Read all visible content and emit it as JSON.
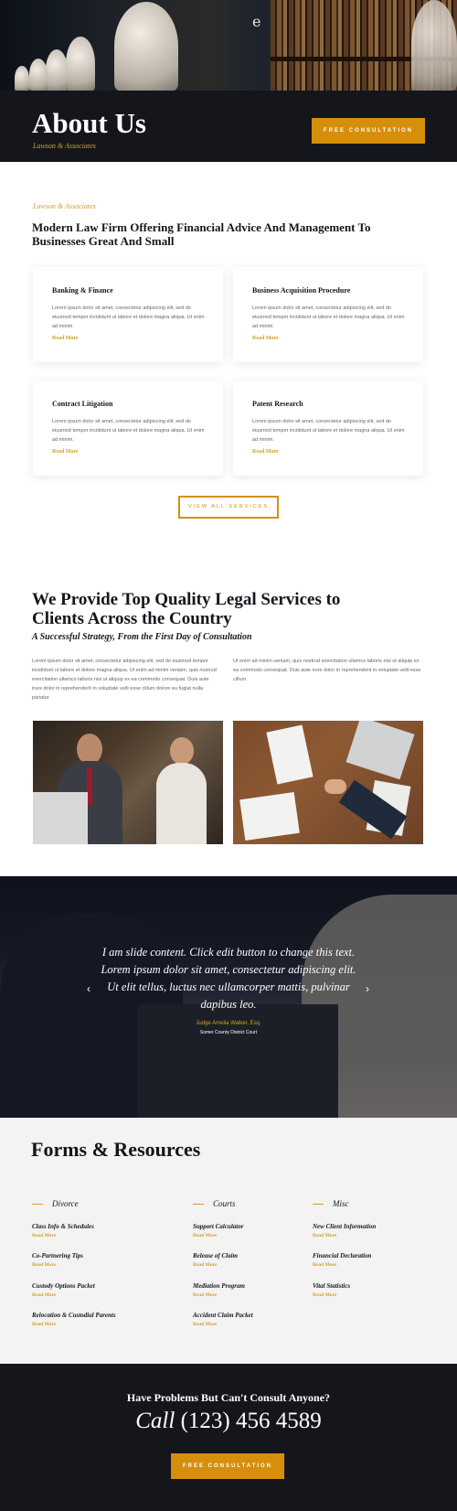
{
  "hero": {
    "logo_glyph": "e"
  },
  "header": {
    "title": "About Us",
    "subtitle": "Lawson & Associates",
    "cta_label": "FREE CONSULTATION"
  },
  "intro": {
    "eyebrow": "Lawson & Associates",
    "heading": "Modern Law Firm Offering Financial Advice And Management To Businesses Great And Small"
  },
  "services": [
    {
      "title": "Banking & Finance",
      "body": "Lorem ipsum dolor sit amet, consectetur adipiscing elit, sed do eiusmod tempor incididunt ut labore et dolore magna aliqua. Ut enim ad minim.",
      "link": "Read More"
    },
    {
      "title": "Business Acquisition Procedure",
      "body": "Lorem ipsum dolor sit amet, consectetur adipiscing elit, sed do eiusmod tempor incididunt ut labore et dolore magna aliqua. Ut enim ad minim.",
      "link": "Read More"
    },
    {
      "title": "Contract Litigation",
      "body": "Lorem ipsum dolor sit amet, consectetur adipiscing elit, sed do eiusmod tempor incididunt ut labore et dolore magna aliqua. Ut enim ad minim.",
      "link": "Read More"
    },
    {
      "title": "Patent Research",
      "body": "Lorem ipsum dolor sit amet, consectetur adipiscing elit, sed do eiusmod tempor incididunt ut labore et dolore magna aliqua. Ut enim ad minim.",
      "link": "Read More"
    }
  ],
  "view_all_label": "VIEW ALL SERVICES",
  "quality": {
    "heading": "We Provide Top Quality Legal Services to Clients Across the Country",
    "subheading": "A Successful Strategy, From the First Day of Consultation",
    "col1": "Lorem ipsum dolor sit amet, consectetur adipiscing elit, sed do eiusmod tempor incididunt ut labore et dolore magna aliqua. Ut enim ad minim veniam, quis nostrud exercitation ullamco laboris nisi ut aliquip ex ea commodo consequat. Duis aute irure dolor in reprehenderit in voluptate velit esse cillum dolore eu fugiat nulla pariatur.",
    "col2": "Ut enim ad minim veniam, quis nostrud exercitation ullamco laboris nisi ut aliquip ex ea commodo consequat. Duis aute irure dolor in reprehenderit in voluptate velit esse cillum."
  },
  "slider": {
    "quote": "I am slide content. Click edit button to change this text. Lorem ipsum dolor sit amet, consectetur adipiscing elit. Ut elit tellus, luctus nec ullamcorper mattis, pulvinar dapibus leo.",
    "name": "Judge Amelia Walker, Esq.",
    "role": "Somer County District Court",
    "prev": "‹",
    "next": "›"
  },
  "forms": {
    "heading": "Forms & Resources",
    "columns": [
      {
        "title": "Divorce",
        "items": [
          {
            "label": "Class Info & Schedules",
            "link": "Read More"
          },
          {
            "label": "Co-Partnering Tips",
            "link": "Read More"
          },
          {
            "label": "Custody Options Packet",
            "link": "Read More"
          },
          {
            "label": "Relocation & Custodial Parents",
            "link": "Read More"
          }
        ]
      },
      {
        "title": "Courts",
        "items": [
          {
            "label": "Support Calculator",
            "link": "Read More"
          },
          {
            "label": "Release of Claim",
            "link": "Read More"
          },
          {
            "label": "Mediation Program",
            "link": "Read More"
          },
          {
            "label": "Accident Claim Packet",
            "link": "Read More"
          }
        ]
      },
      {
        "title": "Misc",
        "items": [
          {
            "label": "New Client Information",
            "link": "Read More"
          },
          {
            "label": "Financial Declaration",
            "link": "Read More"
          },
          {
            "label": "Vital Statistics",
            "link": "Read More"
          }
        ]
      }
    ]
  },
  "cta": {
    "question": "Have Problems But Can't Consult Anyone?",
    "call": "Call",
    "phone": "(123) 456 4589",
    "button_label": "FREE CONSULTATION"
  },
  "colors": {
    "accent": "#d58f0c",
    "dark": "#15161c"
  }
}
